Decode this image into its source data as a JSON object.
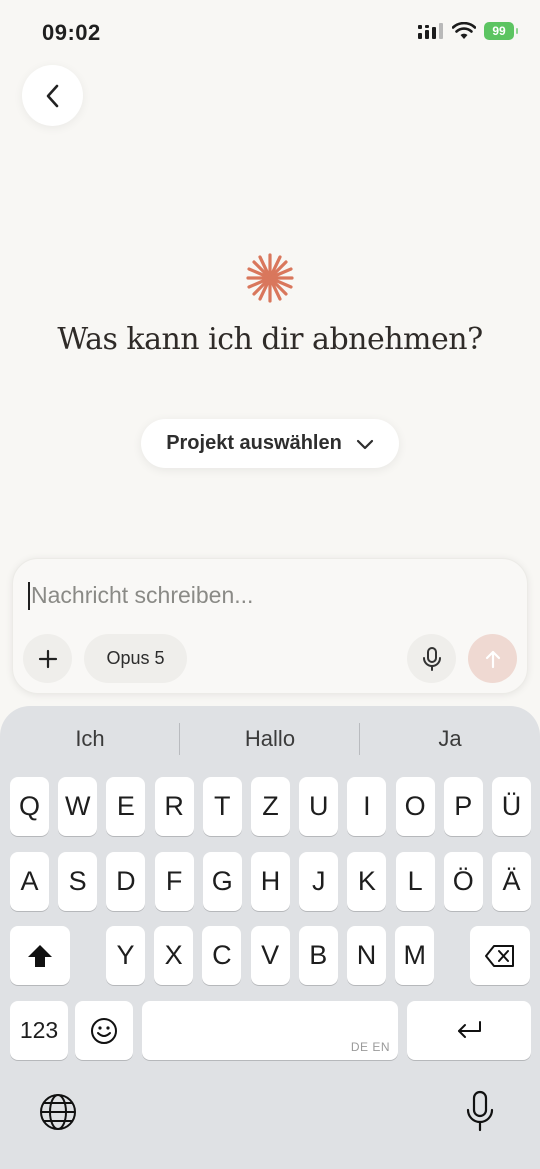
{
  "status": {
    "time": "09:02",
    "battery": "99"
  },
  "header": {
    "back_icon": "chevron-left-icon"
  },
  "main": {
    "headline": "Was kann ich dir abnehmen?",
    "project_label": "Projekt auswählen"
  },
  "composer": {
    "placeholder": "Nachricht schreiben...",
    "model_label": "Opus 5"
  },
  "keyboard": {
    "suggestions": [
      "Ich",
      "Hallo",
      "Ja"
    ],
    "row1": [
      "Q",
      "W",
      "E",
      "R",
      "T",
      "Z",
      "U",
      "I",
      "O",
      "P",
      "Ü"
    ],
    "row2": [
      "A",
      "S",
      "D",
      "F",
      "G",
      "H",
      "J",
      "K",
      "L",
      "Ö",
      "Ä"
    ],
    "row3": [
      "Y",
      "X",
      "C",
      "V",
      "B",
      "N",
      "M"
    ],
    "numbers_label": "123",
    "space_lang": "DE EN"
  },
  "colors": {
    "accent": "#d9775c",
    "send_bg": "#efd9d2",
    "keyboard_bg": "#dfe1e4"
  }
}
